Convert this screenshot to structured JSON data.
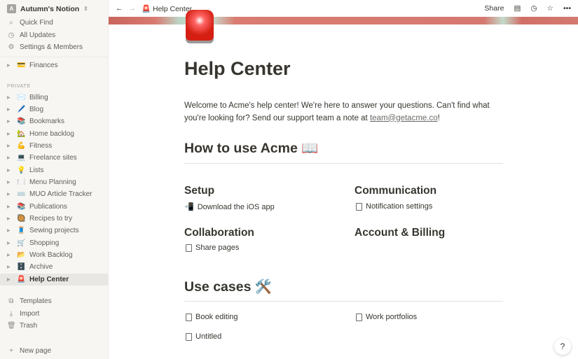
{
  "sidebar": {
    "workspace": "Autumn's Notion",
    "avatar_letter": "A",
    "top": [
      {
        "icon": "search-icon",
        "glyph": "⌕",
        "label": "Quick Find"
      },
      {
        "icon": "clock-icon",
        "glyph": "◷",
        "label": "All Updates"
      },
      {
        "icon": "gear-icon",
        "glyph": "⚙",
        "label": "Settings & Members"
      }
    ],
    "finances": {
      "emoji": "💳",
      "label": "Finances"
    },
    "section_label": "PRIVATE",
    "pages": [
      {
        "emoji": "✉️",
        "label": "Billing"
      },
      {
        "emoji": "🖊️",
        "label": "Blog"
      },
      {
        "emoji": "📚",
        "label": "Bookmarks"
      },
      {
        "emoji": "🏡",
        "label": "Home backlog"
      },
      {
        "emoji": "💪",
        "label": "Fitness"
      },
      {
        "emoji": "💻",
        "label": "Freelance sites"
      },
      {
        "emoji": "💡",
        "label": "Lists"
      },
      {
        "emoji": "🍽️",
        "label": "Menu Planning"
      },
      {
        "emoji": "⌨️",
        "label": "MUO Article Tracker"
      },
      {
        "emoji": "📚",
        "label": "Publications"
      },
      {
        "emoji": "🥘",
        "label": "Recipes to try"
      },
      {
        "emoji": "🧵",
        "label": "Sewing projects"
      },
      {
        "emoji": "🛒",
        "label": "Shopping"
      },
      {
        "emoji": "📂",
        "label": "Work Backlog"
      },
      {
        "emoji": "🗄️",
        "label": "Archive"
      },
      {
        "emoji": "🚨",
        "label": "Help Center"
      }
    ],
    "bottom": [
      {
        "icon": "templates-icon",
        "glyph": "⧉",
        "label": "Templates"
      },
      {
        "icon": "import-icon",
        "glyph": "⤓",
        "label": "Import"
      },
      {
        "icon": "trash-icon",
        "glyph": "🗑",
        "label": "Trash"
      }
    ],
    "new_page": "New page"
  },
  "topbar": {
    "title": "Help Center",
    "emoji": "🚨",
    "share": "Share"
  },
  "page": {
    "title": "Help Center",
    "intro": "Welcome to Acme's help center! We're here to answer your questions. Can't find what you're looking for? Send our support team a note at ",
    "email": "team@getacme.co",
    "intro_end": "!",
    "how_to": "How to use Acme 📖",
    "setup": "Setup",
    "setup_link": "Download the iOS app",
    "setup_emoji": "📲",
    "communication": "Communication",
    "communication_link": "Notification settings",
    "collaboration": "Collaboration",
    "collaboration_link": "Share pages",
    "account": "Account & Billing",
    "use_cases": "Use cases 🛠️",
    "uc_links": [
      "Book editing",
      "Untitled",
      "Work portfolios"
    ]
  },
  "help_button": "?"
}
